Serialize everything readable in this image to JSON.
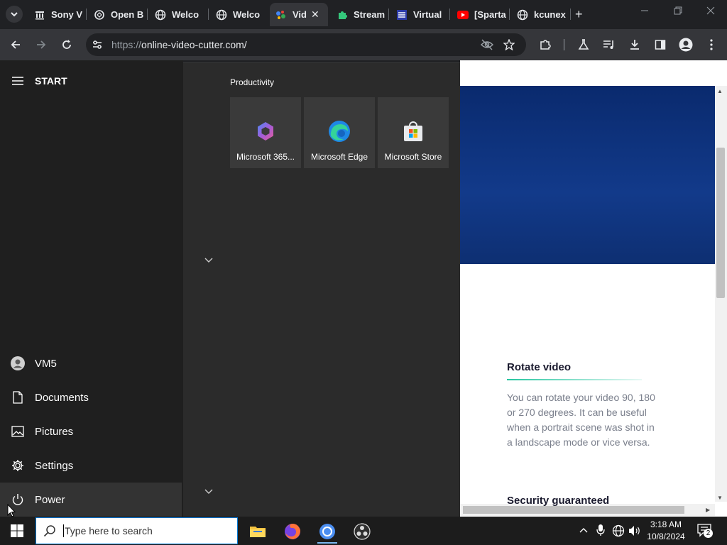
{
  "browser": {
    "tabs": [
      {
        "label": "Sony V",
        "icon": "bank-icon"
      },
      {
        "label": "Open B",
        "icon": "openai-icon"
      },
      {
        "label": "Welco",
        "icon": "globe-icon"
      },
      {
        "label": "Welco",
        "icon": "globe-icon"
      },
      {
        "label": "Vid",
        "icon": "google-assistant-icon",
        "active": true
      },
      {
        "label": "Stream",
        "icon": "puzzle-icon"
      },
      {
        "label": "Virtual",
        "icon": "virtual-icon"
      },
      {
        "label": "[Sparta",
        "icon": "youtube-icon"
      },
      {
        "label": "kcunex",
        "icon": "globe-icon"
      }
    ],
    "new_tab": "+",
    "close_tab": "✕",
    "url_scheme": "https://",
    "url_rest": "online-video-cutter.com/"
  },
  "start_menu": {
    "header": "START",
    "group_label": "Productivity",
    "tiles": [
      {
        "label": "Microsoft 365..."
      },
      {
        "label": "Microsoft Edge"
      },
      {
        "label": "Microsoft Store"
      }
    ],
    "user": "VM5",
    "items": [
      {
        "label": "Documents"
      },
      {
        "label": "Pictures"
      },
      {
        "label": "Settings"
      },
      {
        "label": "Power"
      }
    ]
  },
  "page": {
    "rotate_title": "Rotate video",
    "rotate_body": "You can rotate your video 90, 180 or 270 degrees. It can be useful when a portrait scene was shot in a landscape mode or vice versa.",
    "security_title": "Security guaranteed"
  },
  "taskbar": {
    "search_placeholder": "Type here to search",
    "time": "3:18 AM",
    "date": "10/8/2024",
    "notifications": "2"
  },
  "colors": {
    "accent": "#0078d4",
    "hero": "#0a2a6e",
    "teal": "#26c6a0"
  }
}
